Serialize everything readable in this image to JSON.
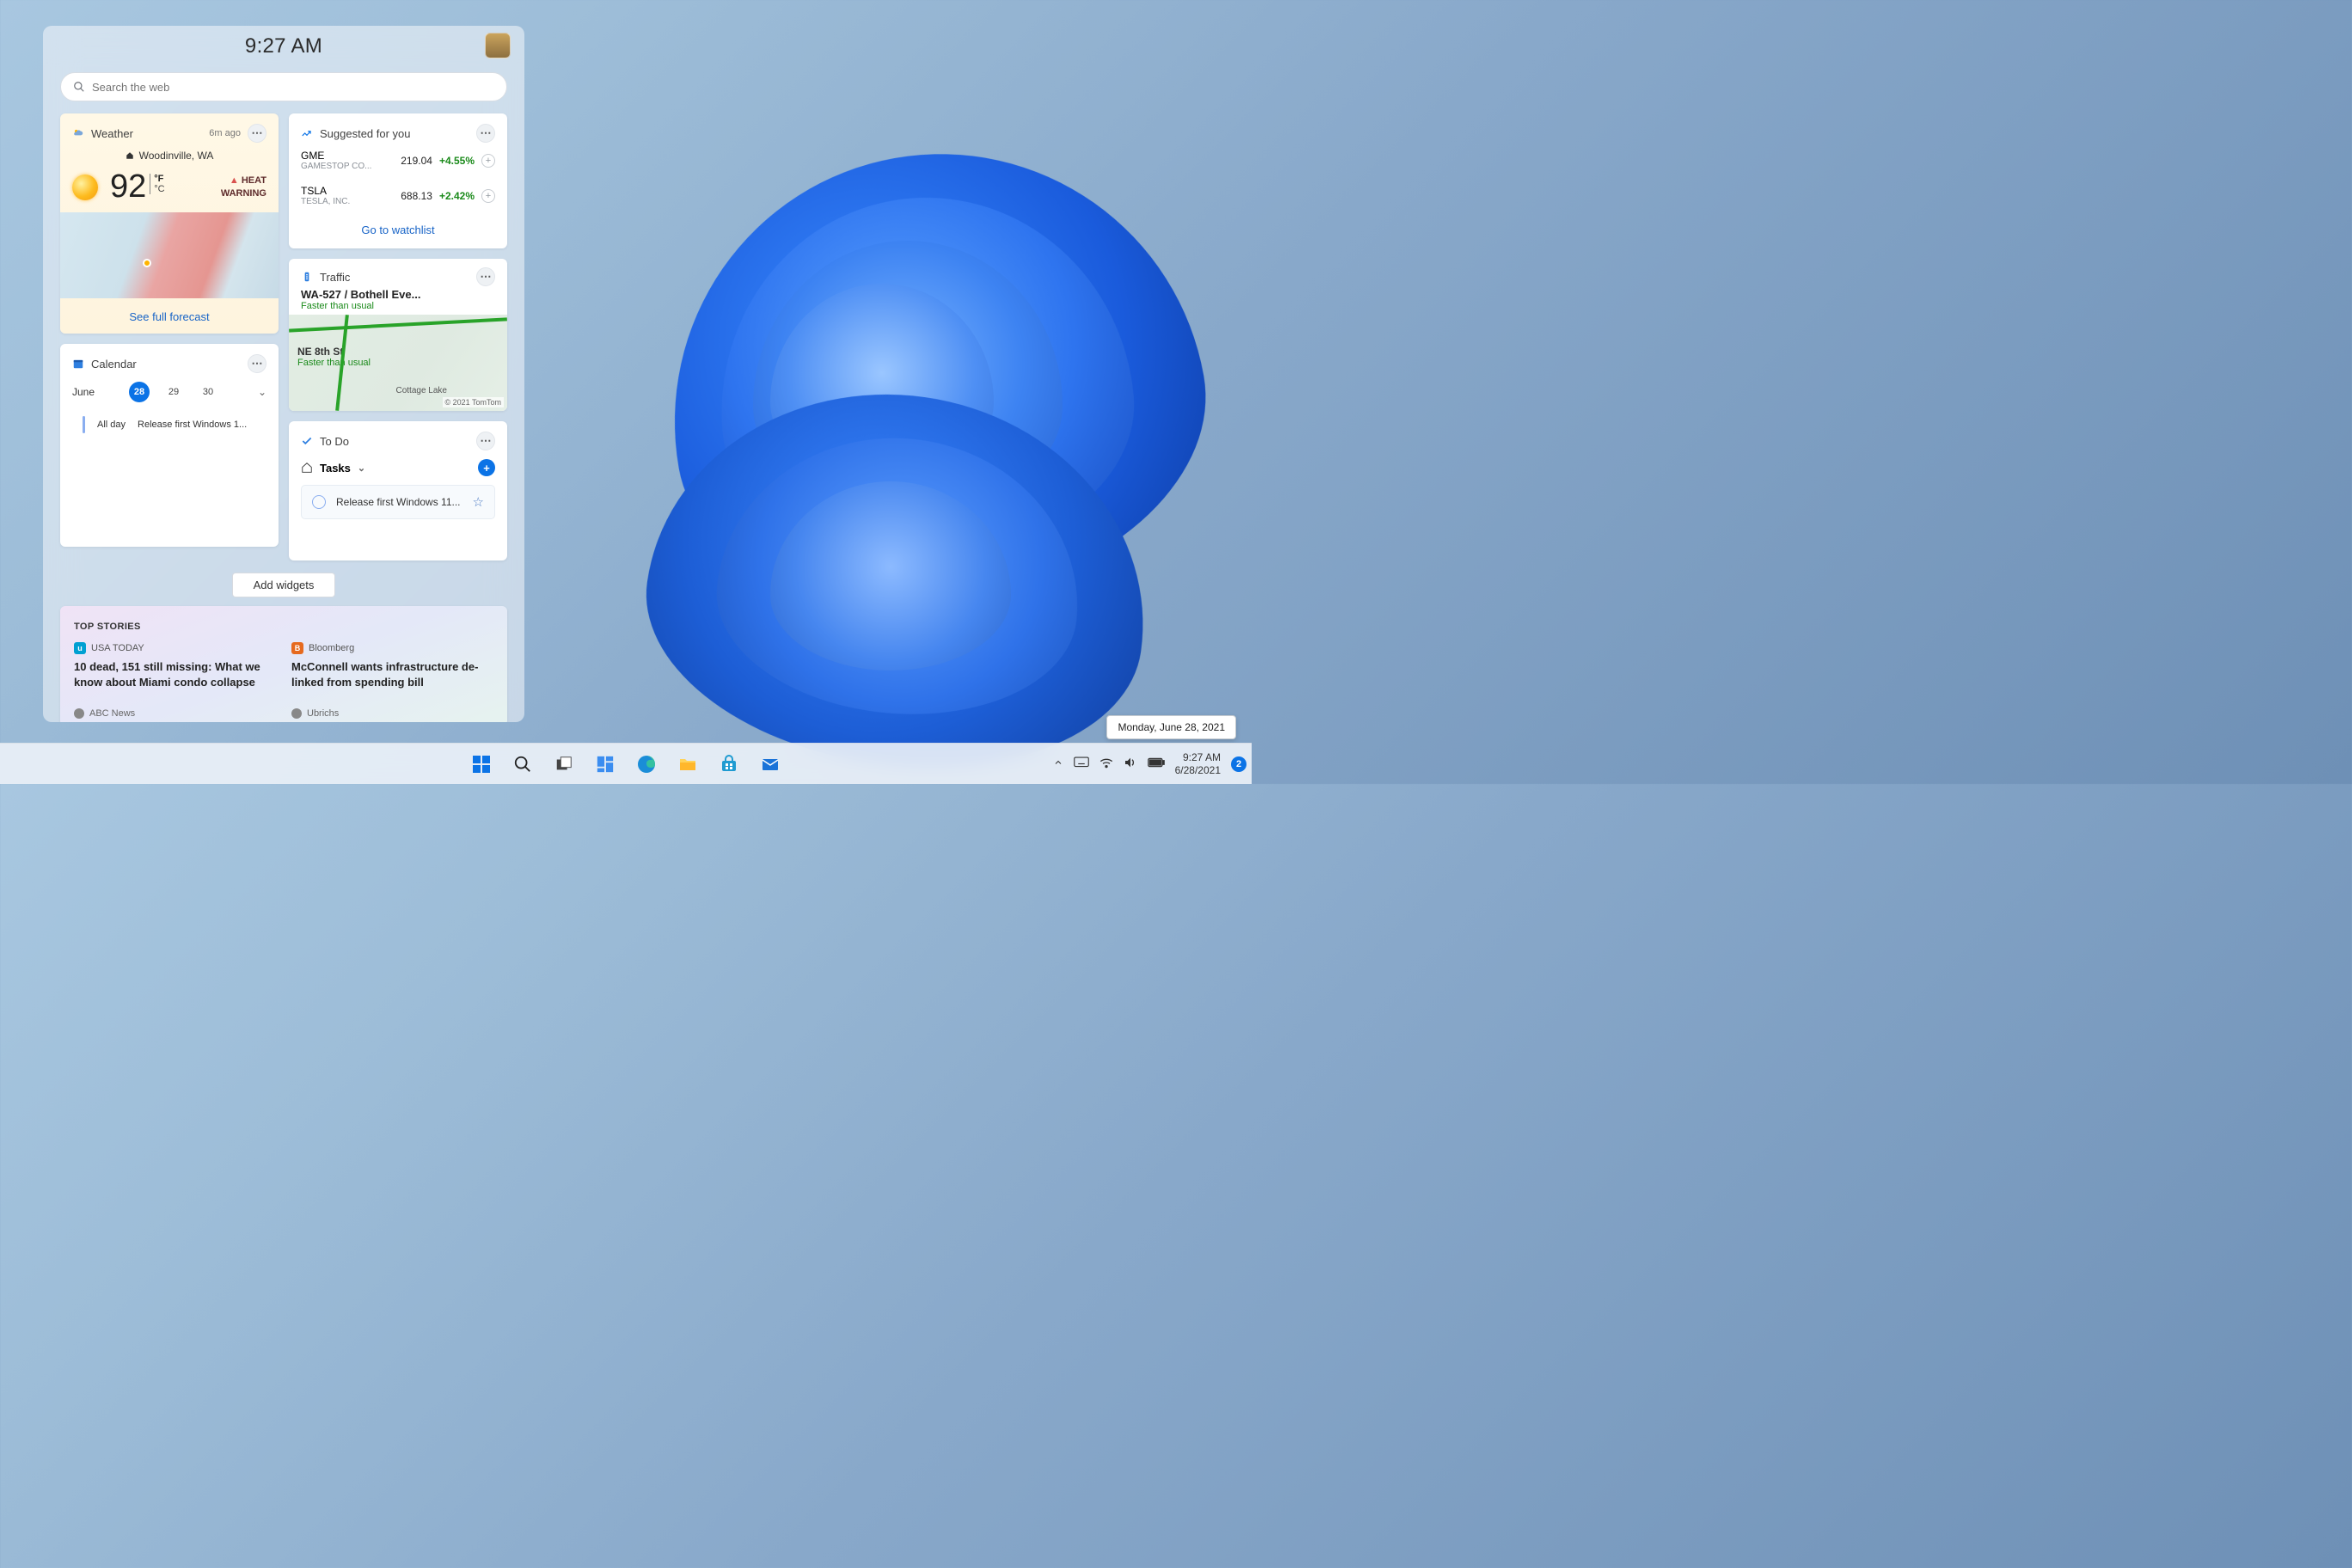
{
  "panel": {
    "time": "9:27 AM",
    "search_placeholder": "Search the web"
  },
  "weather": {
    "title": "Weather",
    "ago": "6m ago",
    "location": "Woodinville, WA",
    "temp": "92",
    "unit_top": "°F",
    "unit_bot": "°C",
    "alert_icon": "▲",
    "alert_line1": "HEAT",
    "alert_line2": "WARNING",
    "forecast_link": "See full forecast"
  },
  "calendar": {
    "title": "Calendar",
    "month": "June",
    "days": [
      "28",
      "29",
      "30"
    ],
    "all_day": "All day",
    "event": "Release first Windows 1..."
  },
  "stocks": {
    "title": "Suggested for you",
    "rows": [
      {
        "sym": "GME",
        "co": "GAMESTOP CO...",
        "price": "219.04",
        "chg": "+4.55%"
      },
      {
        "sym": "TSLA",
        "co": "TESLA, INC.",
        "price": "688.13",
        "chg": "+2.42%"
      }
    ],
    "link": "Go to watchlist"
  },
  "traffic": {
    "title": "Traffic",
    "road": "WA-527 / Bothell Eve...",
    "status1": "Faster than usual",
    "ne8": "NE 8th St",
    "status2": "Faster than usual",
    "lake": "Cottage Lake",
    "attr": "© 2021 TomTom"
  },
  "todo": {
    "title": "To Do",
    "tasks_label": "Tasks",
    "task": "Release first Windows 11..."
  },
  "add_widgets": "Add widgets",
  "stories": {
    "heading": "TOP STORIES",
    "items": [
      {
        "src": "USA TODAY",
        "head": "10 dead, 151 still missing: What we know about Miami condo collapse",
        "sub": "ABC News"
      },
      {
        "src": "Bloomberg",
        "head": "McConnell wants infrastructure de-linked from spending bill",
        "sub": "Ubrichs"
      }
    ]
  },
  "date_tooltip": "Monday, June 28, 2021",
  "taskbar": {
    "time": "9:27 AM",
    "date": "6/28/2021",
    "notif_count": "2"
  }
}
